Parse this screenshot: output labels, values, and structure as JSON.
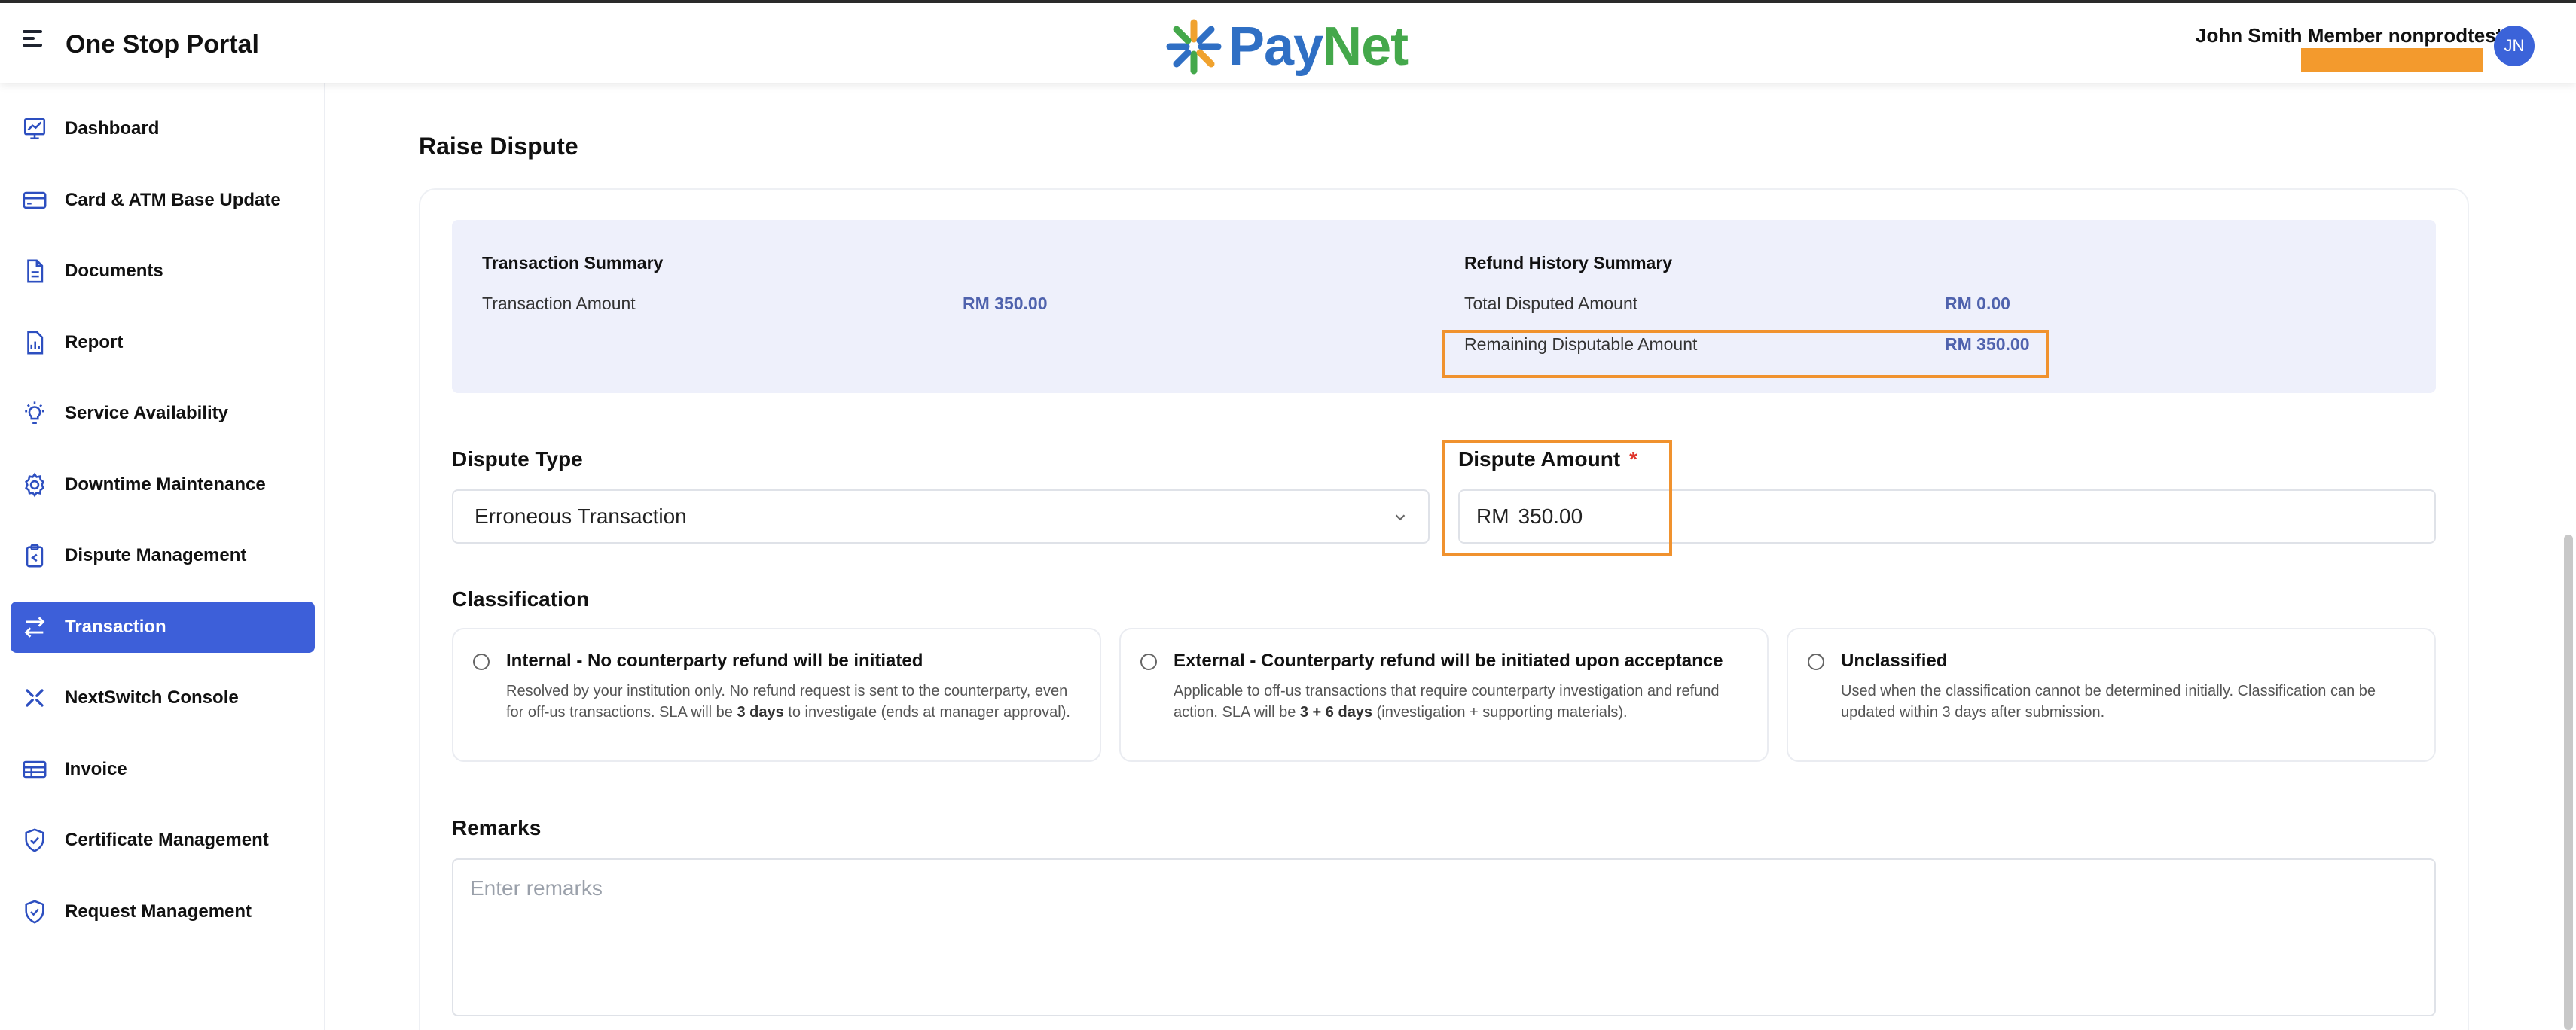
{
  "header": {
    "app_title": "One Stop Portal",
    "logo_pay": "Pay",
    "logo_net": "Net",
    "user_name": "John Smith Member nonprodtest",
    "avatar_initials": "JN"
  },
  "sidebar": {
    "items": [
      {
        "label": "Dashboard",
        "icon": "chart-board-icon"
      },
      {
        "label": "Card & ATM Base Update",
        "icon": "card-icon"
      },
      {
        "label": "Documents",
        "icon": "document-icon"
      },
      {
        "label": "Report",
        "icon": "report-icon"
      },
      {
        "label": "Service Availability",
        "icon": "lightbulb-icon"
      },
      {
        "label": "Downtime Maintenance",
        "icon": "gear-icon"
      },
      {
        "label": "Dispute Management",
        "icon": "clipboard-icon"
      },
      {
        "label": "Transaction",
        "icon": "swap-arrows-icon",
        "active": true
      },
      {
        "label": "NextSwitch Console",
        "icon": "nextswitch-icon"
      },
      {
        "label": "Invoice",
        "icon": "invoice-icon"
      },
      {
        "label": "Certificate Management",
        "icon": "shield-check-icon"
      },
      {
        "label": "Request Management",
        "icon": "shield-check-icon"
      }
    ]
  },
  "main": {
    "page_title": "Raise Dispute",
    "transaction_summary": {
      "heading": "Transaction Summary",
      "amount_label": "Transaction Amount",
      "amount_value": "RM 350.00"
    },
    "refund_summary": {
      "heading": "Refund History Summary",
      "total_label": "Total Disputed Amount",
      "total_value": "RM 0.00",
      "remaining_label": "Remaining Disputable Amount",
      "remaining_value": "RM 350.00"
    },
    "dispute_type": {
      "label": "Dispute Type",
      "value": "Erroneous Transaction"
    },
    "dispute_amount": {
      "label": "Dispute Amount",
      "required_mark": "*",
      "currency": "RM",
      "value": "350.00"
    },
    "classification": {
      "label": "Classification",
      "options": [
        {
          "title": "Internal - No counterparty refund will be initiated",
          "desc_a": "Resolved by your institution only. No refund request is sent to the counterparty, even for off-us transactions. SLA will be ",
          "desc_bold": "3 days",
          "desc_b": " to investigate (ends at manager approval)."
        },
        {
          "title": "External - Counterparty refund will be initiated upon acceptance",
          "desc_a": "Applicable to off-us transactions that require counterparty investigation and refund action. SLA will be ",
          "desc_bold": "3 + 6 days",
          "desc_b": " (investigation + supporting materials)."
        },
        {
          "title": "Unclassified",
          "desc_a": "Used when the classification cannot be determined initially. Classification can be updated within 3 days after submission.",
          "desc_bold": "",
          "desc_b": ""
        }
      ]
    },
    "remarks": {
      "label": "Remarks",
      "placeholder": "Enter remarks"
    }
  },
  "colors": {
    "accent": "#3d5fd9",
    "summary_bg": "#eef0fb",
    "value_text": "#4f62ad",
    "highlight": "#f0922e",
    "redaction": "#f39a2d"
  }
}
